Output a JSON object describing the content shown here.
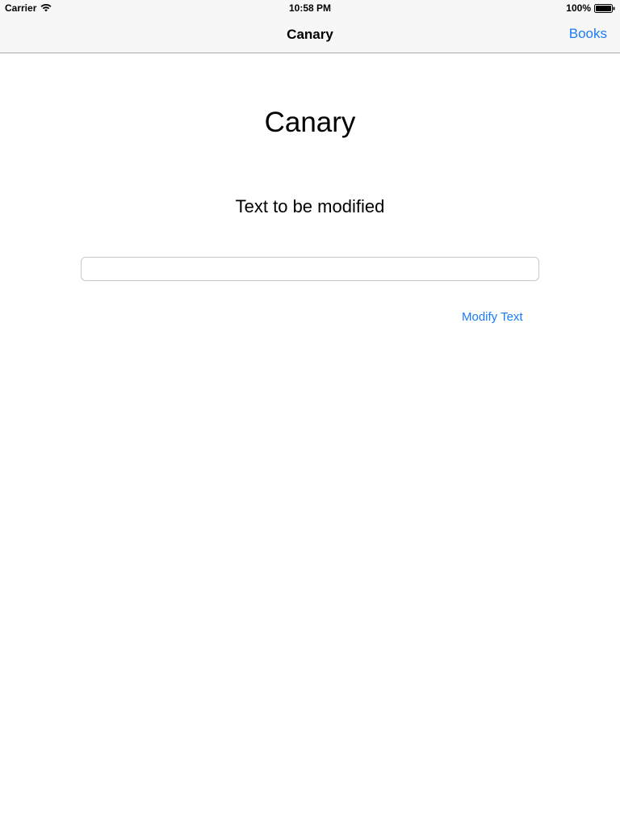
{
  "status_bar": {
    "carrier": "Carrier",
    "time": "10:58 PM",
    "battery": "100%"
  },
  "nav_bar": {
    "title": "Canary",
    "right_button": "Books"
  },
  "main": {
    "title": "Canary",
    "label": "Text to be modified",
    "input_value": "",
    "input_placeholder": "",
    "action_button": "Modify Text"
  },
  "colors": {
    "accent": "#1a7cf7",
    "bar_background": "#f7f7f7"
  },
  "icons": [
    "wifi-icon",
    "battery-icon"
  ]
}
